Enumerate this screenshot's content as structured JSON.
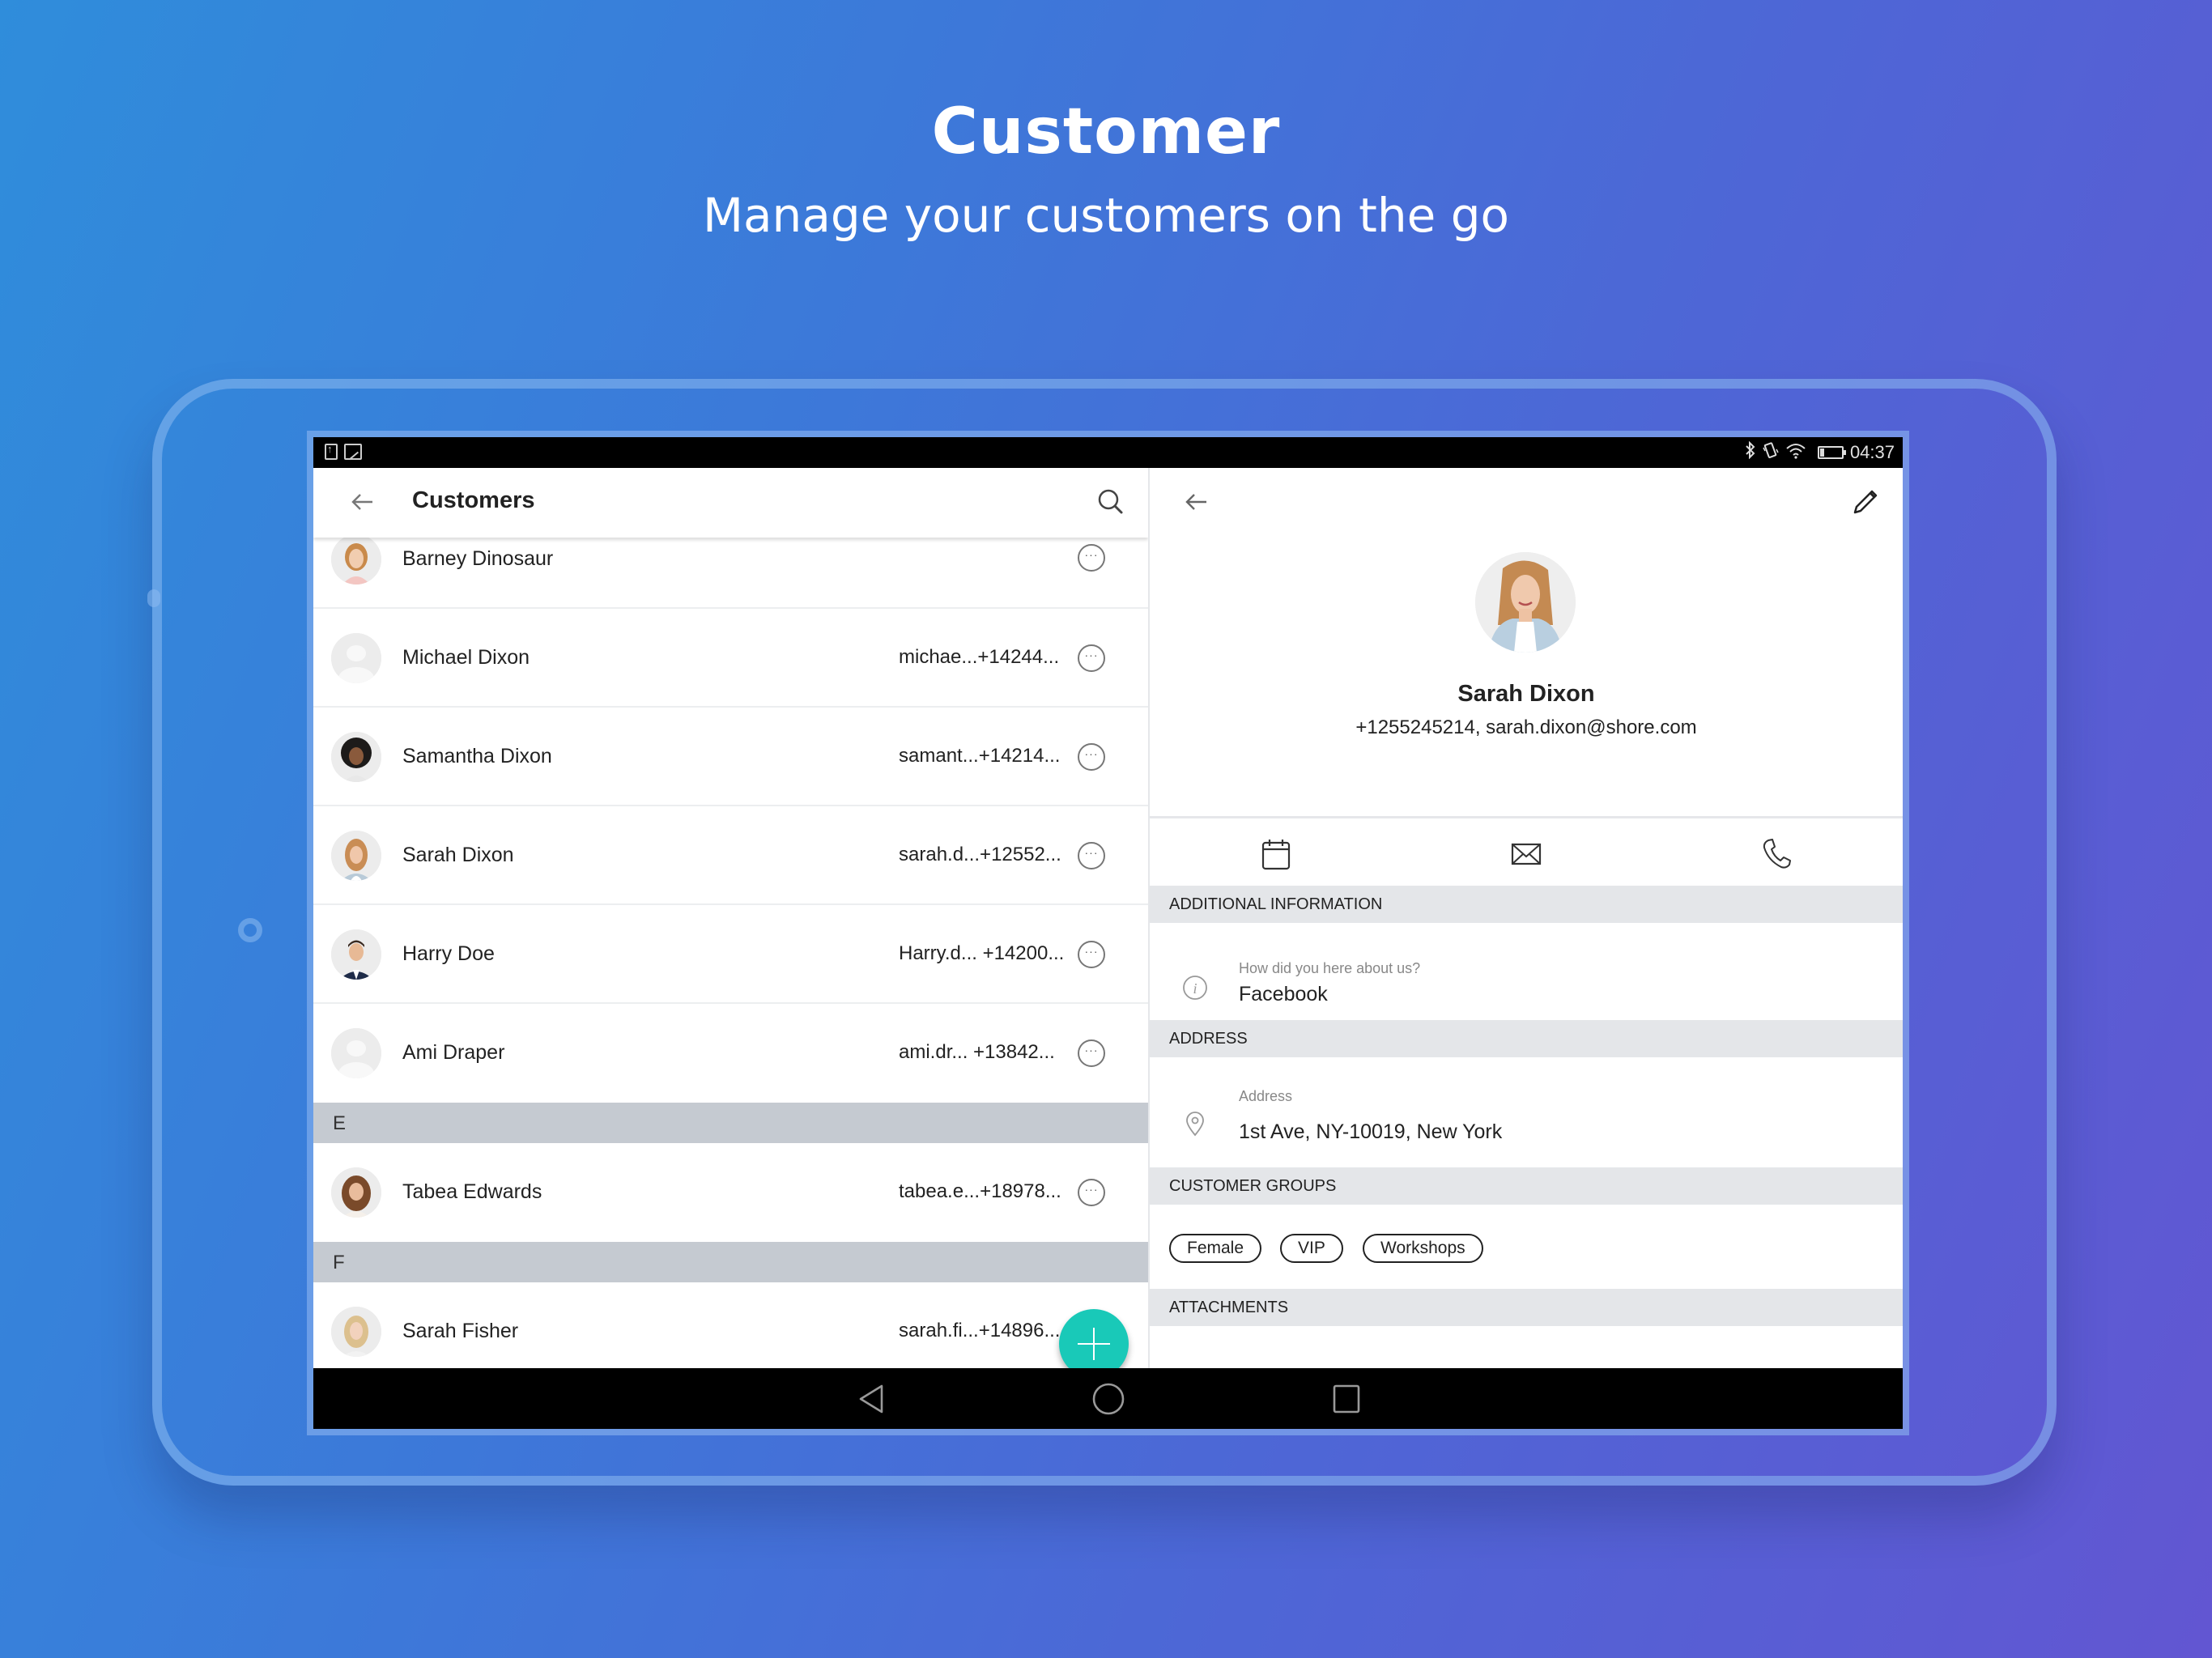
{
  "hero": {
    "title": "Customer",
    "subtitle": "Manage your customers on the go"
  },
  "status_bar": {
    "left_icons": [
      "upload-notification-icon",
      "image-notification-icon"
    ],
    "right_icons": [
      "bluetooth-icon",
      "vibrate-icon",
      "wifi-icon",
      "battery-icon"
    ],
    "time": "04:37"
  },
  "customers_pane": {
    "title": "Customers",
    "back_icon": "arrow-left-icon",
    "search_icon": "search-icon",
    "sections": [
      {
        "letter": "",
        "items": [
          {
            "name": "Barney Dinosaur",
            "contact": "",
            "avatar": "photo"
          },
          {
            "name": "Michael Dixon",
            "contact": "michae...+14244...",
            "avatar": "placeholder"
          },
          {
            "name": "Samantha Dixon",
            "contact": "samant...+14214...",
            "avatar": "photo"
          },
          {
            "name": "Sarah Dixon",
            "contact": "sarah.d...+12552...",
            "avatar": "photo"
          },
          {
            "name": "Harry Doe",
            "contact": "Harry.d... +14200...",
            "avatar": "photo"
          },
          {
            "name": "Ami Draper",
            "contact": "ami.dr...  +13842...",
            "avatar": "placeholder"
          }
        ]
      },
      {
        "letter": "E",
        "items": [
          {
            "name": "Tabea Edwards",
            "contact": "tabea.e...+18978...",
            "avatar": "photo"
          }
        ]
      },
      {
        "letter": "F",
        "items": [
          {
            "name": "Sarah Fisher",
            "contact": "sarah.fi...+14896...",
            "avatar": "photo"
          }
        ]
      }
    ],
    "more_label": "···",
    "fab_icon": "plus-icon"
  },
  "detail_pane": {
    "name": "Sarah Dixon",
    "contact_line": "+1255245214, sarah.dixon@shore.com",
    "actions": [
      "calendar-icon",
      "mail-icon",
      "phone-icon"
    ],
    "sections": {
      "additional_information": "ADDITIONAL INFORMATION",
      "address": "ADDRESS",
      "customer_groups": "CUSTOMER GROUPS",
      "attachments": "ATTACHMENTS"
    },
    "additional_info": {
      "label": "How did you here about us?",
      "value": "Facebook"
    },
    "address": {
      "label": "Address",
      "value": "1st Ave, NY-10019, New York"
    },
    "groups": [
      "Female",
      "VIP",
      "Workshops"
    ]
  },
  "nav_bar": {
    "buttons": [
      "back-triangle-icon",
      "home-circle-icon",
      "recents-square-icon"
    ]
  },
  "colors": {
    "accent": "#19c9b8",
    "section_header_list": "#c5cad1",
    "section_header_detail": "#e4e6e9",
    "background_start": "#2f8ddb",
    "background_end": "#6256d2"
  }
}
